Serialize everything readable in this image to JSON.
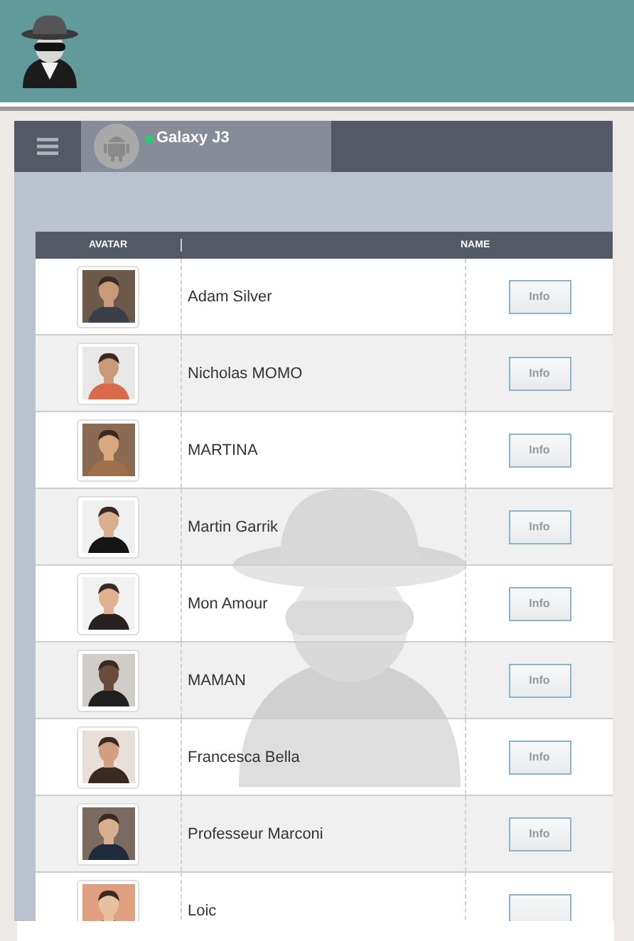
{
  "device": {
    "name": "Galaxy J3",
    "online": true
  },
  "table": {
    "columns": [
      "AVATAR",
      "NAME"
    ],
    "rows": [
      {
        "name": "Adam Silver",
        "button": "Info"
      },
      {
        "name": "Nicholas MOMO",
        "button": "Info"
      },
      {
        "name": "MARTINA",
        "button": "Info"
      },
      {
        "name": "Martin Garrik",
        "button": "Info"
      },
      {
        "name": "Mon Amour",
        "button": "Info"
      },
      {
        "name": "MAMAN",
        "button": "Info"
      },
      {
        "name": "Francesca Bella",
        "button": "Info"
      },
      {
        "name": "Professeur Marconi",
        "button": "Info"
      },
      {
        "name": "Loic"
      }
    ]
  }
}
